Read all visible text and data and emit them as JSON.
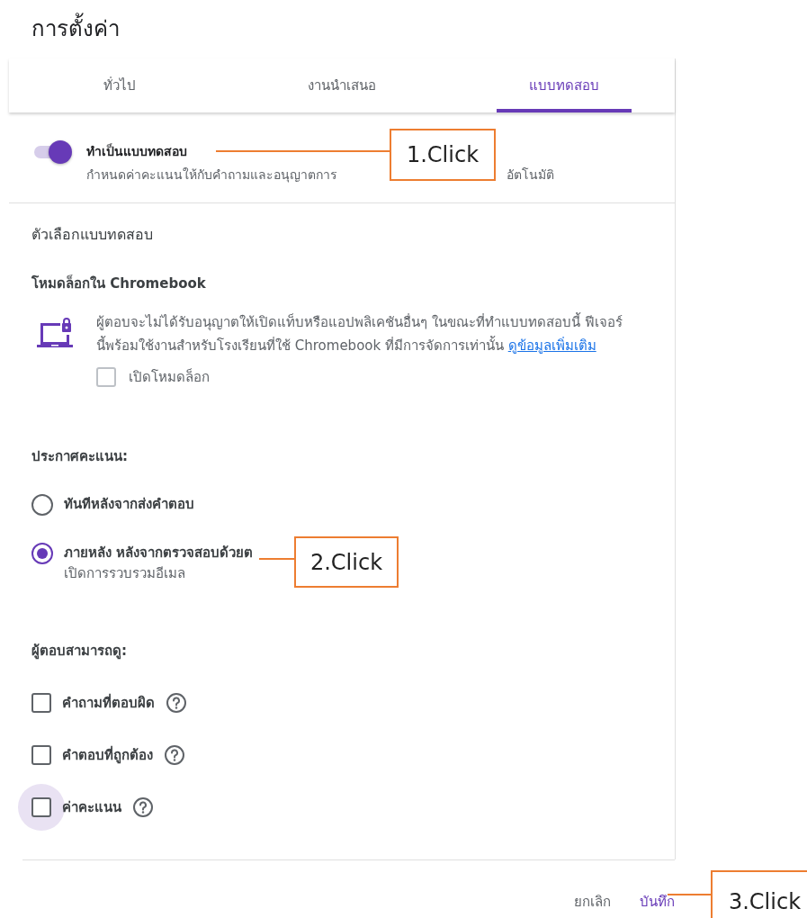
{
  "title": "การตั้งค่า",
  "tabs": [
    {
      "label": "ทั่วไป",
      "selected": false
    },
    {
      "label": "งานนำเสนอ",
      "selected": false
    },
    {
      "label": "แบบทดสอบ",
      "selected": true
    }
  ],
  "quiz_toggle": {
    "label": "ทำเป็นแบบทดสอบ",
    "on": true,
    "description_parts": [
      "กำหนดค่าคะแนนให้กับคำถามและอนุญาตการ",
      "อัตโนมัติ"
    ]
  },
  "quiz_options": {
    "heading": "ตัวเลือกแบบทดสอบ",
    "lock_mode": {
      "heading": "โหมดล็อกใน Chromebook",
      "description": "ผู้ตอบจะไม่ได้รับอนุญาตให้เปิดแท็บหรือแอปพลิเคชันอื่นๆ ในขณะที่ทำแบบทดสอบนี้ ฟีเจอร์นี้พร้อมใช้งานสำหรับโรงเรียนที่ใช้ Chromebook ที่มีการจัดการเท่านั้น",
      "link": "ดูข้อมูลเพิ่มเติม",
      "checkbox": {
        "label": "เปิดโหมดล็อก",
        "checked": false
      }
    }
  },
  "release_grade": {
    "heading": "ประกาศคะแนน:",
    "options": [
      {
        "label": "ทันทีหลังจากส่งคำตอบ",
        "selected": false
      },
      {
        "label": "ภายหลัง หลังจากตรวจสอบด้วยต",
        "sublabel": "เปิดการรวบรวมอีเมล",
        "selected": true
      }
    ]
  },
  "respondents_can_see": {
    "heading": "ผู้ตอบสามารถดู:",
    "items": [
      {
        "label": "คำถามที่ตอบผิด",
        "checked": false,
        "focused": false
      },
      {
        "label": "คำตอบที่ถูกต้อง",
        "checked": false,
        "focused": false
      },
      {
        "label": "ค่าคะแนน",
        "checked": false,
        "focused": true
      }
    ]
  },
  "buttons": [
    {
      "label": "ยกเลิก",
      "kind": "text"
    },
    {
      "label": "บันทึก",
      "kind": "primary"
    }
  ],
  "annotations": [
    {
      "label": "1.Click"
    },
    {
      "label": "2.Click"
    },
    {
      "label": "3.Click"
    }
  ]
}
